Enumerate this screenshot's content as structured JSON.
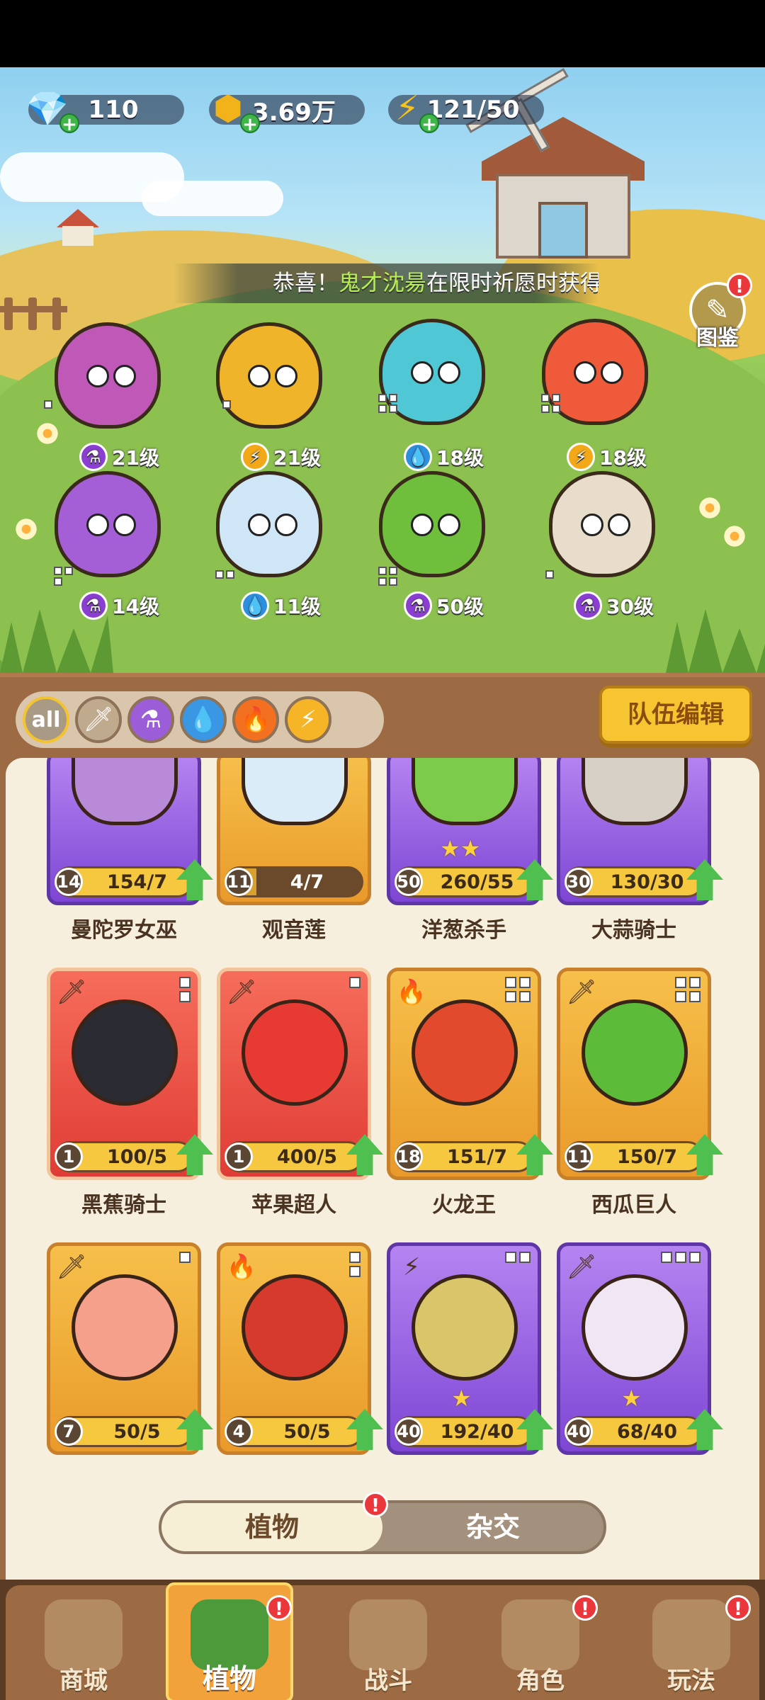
{
  "resources": {
    "gems": "110",
    "coins": "3.69万",
    "energy": "121/50"
  },
  "ticker": {
    "prefix": "恭喜！",
    "name": "鬼才沈昜",
    "suffix": "在限时祈愿时获得"
  },
  "codex": {
    "label": "图鉴",
    "badge": "!"
  },
  "team": [
    {
      "level": "21级",
      "element": "purple"
    },
    {
      "level": "21级",
      "element": "yellow"
    },
    {
      "level": "18级",
      "element": "blue"
    },
    {
      "level": "18级",
      "element": "yellow"
    },
    {
      "level": "14级",
      "element": "purple"
    },
    {
      "level": "11级",
      "element": "blue"
    },
    {
      "level": "50级",
      "element": "purple"
    },
    {
      "level": "30级",
      "element": "purple"
    }
  ],
  "filters": {
    "all": "all",
    "team_edit": "队伍编辑"
  },
  "cards": [
    {
      "name": "曼陀罗女巫",
      "level": "14",
      "count": "154/7"
    },
    {
      "name": "观音莲",
      "level": "11",
      "count": "4/7"
    },
    {
      "name": "洋葱杀手",
      "level": "50",
      "count": "260/55",
      "stars": "★★"
    },
    {
      "name": "大蒜骑士",
      "level": "30",
      "count": "130/30"
    },
    {
      "name": "黑蕉骑士",
      "level": "1",
      "count": "100/5"
    },
    {
      "name": "苹果超人",
      "level": "1",
      "count": "400/5"
    },
    {
      "name": "火龙王",
      "level": "18",
      "count": "151/7"
    },
    {
      "name": "西瓜巨人",
      "level": "11",
      "count": "150/7"
    },
    {
      "name": "",
      "level": "7",
      "count": "50/5"
    },
    {
      "name": "",
      "level": "4",
      "count": "50/5"
    },
    {
      "name": "",
      "level": "40",
      "count": "192/40",
      "stars": "★"
    },
    {
      "name": "",
      "level": "40",
      "count": "68/40",
      "stars": "★"
    }
  ],
  "toggle": {
    "plants": "植物",
    "hybrid": "杂交",
    "badge": "!"
  },
  "nav": {
    "shop": "商城",
    "plants": "植物",
    "battle": "战斗",
    "role": "角色",
    "play": "玩法",
    "badge": "!"
  },
  "colors": {
    "accent": "#f7c531",
    "wood": "#9c6a43",
    "panel": "#f7efde"
  }
}
